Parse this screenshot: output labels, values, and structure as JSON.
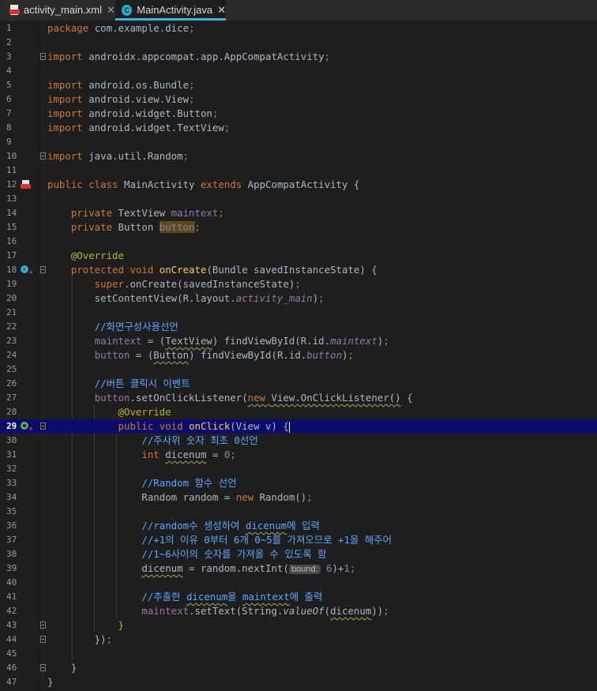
{
  "tabs": [
    {
      "label": "activity_main.xml",
      "icon": "xml-file-icon",
      "active": false
    },
    {
      "label": "MainActivity.java",
      "icon": "java-class-icon",
      "active": true
    }
  ],
  "lines": [
    {
      "n": "1",
      "t": [
        [
          "kw",
          "package "
        ],
        [
          "txt",
          "com.example.dice"
        ],
        [
          "kw",
          ";"
        ]
      ]
    },
    {
      "n": "2",
      "t": []
    },
    {
      "n": "3",
      "fold": true,
      "t": [
        [
          "kw",
          "import "
        ],
        [
          "txt",
          "androidx.appcompat.app.AppCompatActivity"
        ],
        [
          "kw",
          ";"
        ]
      ]
    },
    {
      "n": "4",
      "t": []
    },
    {
      "n": "5",
      "t": [
        [
          "kw",
          "import "
        ],
        [
          "txt",
          "android.os.Bundle"
        ],
        [
          "kw",
          ";"
        ]
      ]
    },
    {
      "n": "6",
      "t": [
        [
          "kw",
          "import "
        ],
        [
          "txt",
          "android.view.View"
        ],
        [
          "kw",
          ";"
        ]
      ]
    },
    {
      "n": "7",
      "t": [
        [
          "kw",
          "import "
        ],
        [
          "txt",
          "android.widget.Button"
        ],
        [
          "kw",
          ";"
        ]
      ]
    },
    {
      "n": "8",
      "t": [
        [
          "kw",
          "import "
        ],
        [
          "txt",
          "android.widget.TextView"
        ],
        [
          "kw",
          ";"
        ]
      ]
    },
    {
      "n": "9",
      "t": []
    },
    {
      "n": "10",
      "fold": true,
      "t": [
        [
          "kw",
          "import "
        ],
        [
          "txt",
          "java.util.Random"
        ],
        [
          "kw",
          ";"
        ]
      ]
    },
    {
      "n": "11",
      "t": []
    },
    {
      "n": "12",
      "icon": "layout",
      "t": [
        [
          "kw",
          "public class "
        ],
        [
          "txt",
          "MainActivity "
        ],
        [
          "kw",
          "extends "
        ],
        [
          "txt",
          "AppCompatActivity {"
        ]
      ]
    },
    {
      "n": "13",
      "t": []
    },
    {
      "n": "14",
      "t": [
        [
          "txt",
          "    "
        ],
        [
          "kw",
          "private "
        ],
        [
          "txt",
          "TextView "
        ],
        [
          "fld",
          "maintext"
        ],
        [
          "kw",
          ";"
        ]
      ]
    },
    {
      "n": "15",
      "t": [
        [
          "txt",
          "    "
        ],
        [
          "kw",
          "private "
        ],
        [
          "txt",
          "Button "
        ],
        [
          "fld hl",
          "button"
        ],
        [
          "kw",
          ";"
        ]
      ]
    },
    {
      "n": "16",
      "t": []
    },
    {
      "n": "17",
      "t": [
        [
          "txt",
          "    "
        ],
        [
          "ann",
          "@Override"
        ]
      ]
    },
    {
      "n": "18",
      "icon": "override",
      "fold": true,
      "t": [
        [
          "txt",
          "    "
        ],
        [
          "kw",
          "protected void "
        ],
        [
          "fn",
          "onCreate"
        ],
        [
          "txt",
          "(Bundle savedInstanceState) {"
        ]
      ]
    },
    {
      "n": "19",
      "t": [
        [
          "txt",
          "        "
        ],
        [
          "kw",
          "super"
        ],
        [
          "txt",
          "."
        ],
        [
          "txt",
          "onCreate(savedInstanceState)"
        ],
        [
          "kw",
          ";"
        ]
      ]
    },
    {
      "n": "20",
      "t": [
        [
          "txt",
          "        setContentView(R.layout."
        ],
        [
          "fld it",
          "activity_main"
        ],
        [
          "txt",
          ")"
        ],
        [
          "kw",
          ";"
        ]
      ]
    },
    {
      "n": "21",
      "t": []
    },
    {
      "n": "22",
      "t": [
        [
          "txt",
          "        "
        ],
        [
          "cm",
          "//화면구성사용선언"
        ]
      ]
    },
    {
      "n": "23",
      "t": [
        [
          "txt",
          "        "
        ],
        [
          "fld",
          "maintext"
        ],
        [
          "txt",
          " = ("
        ],
        [
          "txt wavy",
          "TextView"
        ],
        [
          "txt",
          ") findViewById(R.id."
        ],
        [
          "fld it",
          "maintext"
        ],
        [
          "txt",
          ")"
        ],
        [
          "kw",
          ";"
        ]
      ]
    },
    {
      "n": "24",
      "t": [
        [
          "txt",
          "        "
        ],
        [
          "fld",
          "button"
        ],
        [
          "txt",
          " = ("
        ],
        [
          "txt wavy",
          "Button"
        ],
        [
          "txt",
          ") findViewById(R.id."
        ],
        [
          "fld it",
          "button"
        ],
        [
          "txt",
          ")"
        ],
        [
          "kw",
          ";"
        ]
      ]
    },
    {
      "n": "25",
      "t": []
    },
    {
      "n": "26",
      "t": [
        [
          "txt",
          "        "
        ],
        [
          "cm",
          "//버튼 클릭시 이벤트"
        ]
      ]
    },
    {
      "n": "27",
      "t": [
        [
          "txt",
          "        "
        ],
        [
          "fld",
          "button"
        ],
        [
          "txt",
          ".setOnClickListener("
        ],
        [
          "kw wavy",
          "new "
        ],
        [
          "txt wavy",
          "View.OnClickListener()"
        ],
        [
          "txt",
          " {"
        ]
      ]
    },
    {
      "n": "28",
      "t": [
        [
          "txt",
          "            "
        ],
        [
          "ann",
          "@Override"
        ]
      ]
    },
    {
      "n": "29",
      "icon": "implement",
      "fold": true,
      "current": true,
      "t": [
        [
          "txt",
          "            "
        ],
        [
          "kw",
          "public void "
        ],
        [
          "fn",
          "onClick"
        ],
        [
          "txt",
          "(View v) {"
        ],
        [
          "caret",
          ""
        ]
      ]
    },
    {
      "n": "30",
      "t": [
        [
          "txt",
          "                "
        ],
        [
          "cm",
          "//주사위 숫자 최초 0선언"
        ]
      ]
    },
    {
      "n": "31",
      "t": [
        [
          "txt",
          "                "
        ],
        [
          "kw",
          "int "
        ],
        [
          "txt wavy",
          "dicenum"
        ],
        [
          "txt",
          " = "
        ],
        [
          "num",
          "0"
        ],
        [
          "kw",
          ";"
        ]
      ]
    },
    {
      "n": "32",
      "t": []
    },
    {
      "n": "33",
      "t": [
        [
          "txt",
          "                "
        ],
        [
          "cm",
          "//Random 함수 선언"
        ]
      ]
    },
    {
      "n": "34",
      "t": [
        [
          "txt",
          "                Random random = "
        ],
        [
          "kw",
          "new "
        ],
        [
          "txt",
          "Random()"
        ],
        [
          "kw",
          ";"
        ]
      ]
    },
    {
      "n": "35",
      "t": []
    },
    {
      "n": "36",
      "t": [
        [
          "txt",
          "                "
        ],
        [
          "cm",
          "//random수 생성하여 "
        ],
        [
          "cm wavy",
          "dicenum"
        ],
        [
          "cm",
          "에 입력"
        ]
      ]
    },
    {
      "n": "37",
      "t": [
        [
          "txt",
          "                "
        ],
        [
          "cm",
          "//+1의 이유 0부터 6개 0~5를 가져오므로 +1을 해주어"
        ]
      ]
    },
    {
      "n": "38",
      "t": [
        [
          "txt",
          "                "
        ],
        [
          "cm",
          "//1~6사이의 숫자를 가져올 수 있도록 함"
        ]
      ]
    },
    {
      "n": "39",
      "t": [
        [
          "txt",
          "                "
        ],
        [
          "txt wavy",
          "dicenum"
        ],
        [
          "txt",
          " = random.nextInt("
        ],
        [
          "hint",
          "bound:"
        ],
        [
          "num",
          " 6"
        ],
        [
          "txt",
          ")+"
        ],
        [
          "num",
          "1"
        ],
        [
          "kw",
          ";"
        ]
      ]
    },
    {
      "n": "40",
      "t": []
    },
    {
      "n": "41",
      "t": [
        [
          "txt",
          "                "
        ],
        [
          "cm",
          "//추출한 "
        ],
        [
          "cm wavy",
          "dicenum"
        ],
        [
          "cm",
          "을 "
        ],
        [
          "cm wavy",
          "maintext"
        ],
        [
          "cm",
          "에 출력"
        ]
      ]
    },
    {
      "n": "42",
      "t": [
        [
          "txt",
          "                "
        ],
        [
          "fld",
          "maintext"
        ],
        [
          "txt",
          ".setText(String."
        ],
        [
          "txt it",
          "valueOf"
        ],
        [
          "txt",
          "("
        ],
        [
          "txt wavy",
          "dicenum"
        ],
        [
          "txt",
          "))"
        ],
        [
          "kw",
          ";"
        ]
      ]
    },
    {
      "n": "43",
      "fold": true,
      "t": [
        [
          "txt",
          "            "
        ],
        [
          "ann",
          "}"
        ]
      ]
    },
    {
      "n": "44",
      "fold": true,
      "t": [
        [
          "txt",
          "        })"
        ],
        [
          "kw",
          ";"
        ]
      ]
    },
    {
      "n": "45",
      "t": []
    },
    {
      "n": "46",
      "fold": true,
      "t": [
        [
          "txt",
          "    }"
        ]
      ]
    },
    {
      "n": "47",
      "t": [
        [
          "txt",
          "}"
        ]
      ]
    }
  ]
}
